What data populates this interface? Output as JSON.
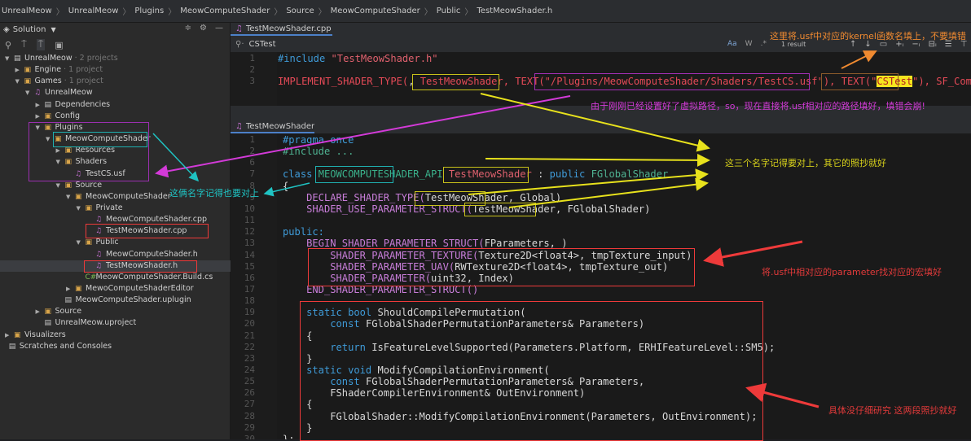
{
  "breadcrumb": [
    "UnrealMeow",
    "UnrealMeow",
    "Plugins",
    "MeowComputeShader",
    "Source",
    "MeowComputeShader",
    "Public",
    "TestMeowShader.h"
  ],
  "sidebar": {
    "title": "Solution",
    "tree": [
      {
        "label": "UnrealMeow",
        "suffix": " · 2 projects",
        "d": 0,
        "a": "▼",
        "icon": "proj"
      },
      {
        "label": "Engine",
        "suffix": " · 1 project",
        "d": 1,
        "a": "▶",
        "icon": "fold"
      },
      {
        "label": "Games",
        "suffix": " · 1 project",
        "d": 1,
        "a": "▼",
        "icon": "fold"
      },
      {
        "label": "UnrealMeow",
        "suffix": "",
        "d": 2,
        "a": "▼",
        "icon": "file"
      },
      {
        "label": "Dependencies",
        "suffix": "",
        "d": 3,
        "a": "▶",
        "icon": "proj"
      },
      {
        "label": "Config",
        "suffix": "",
        "d": 3,
        "a": "▶",
        "icon": "fold"
      },
      {
        "label": "Plugins",
        "suffix": "",
        "d": 3,
        "a": "▼",
        "icon": "fold"
      },
      {
        "label": "MeowComputeShader",
        "suffix": "",
        "d": 4,
        "a": "▼",
        "icon": "fold"
      },
      {
        "label": "Resources",
        "suffix": "",
        "d": 5,
        "a": "▶",
        "icon": "fold"
      },
      {
        "label": "Shaders",
        "suffix": "",
        "d": 5,
        "a": "▼",
        "icon": "fold"
      },
      {
        "label": "TestCS.usf",
        "suffix": "",
        "d": 6,
        "a": "",
        "icon": "file"
      },
      {
        "label": "Source",
        "suffix": "",
        "d": 5,
        "a": "▼",
        "icon": "fold"
      },
      {
        "label": "MeowComputeShader",
        "suffix": "",
        "d": 6,
        "a": "▼",
        "icon": "fold"
      },
      {
        "label": "Private",
        "suffix": "",
        "d": 7,
        "a": "▼",
        "icon": "fold"
      },
      {
        "label": "MeowComputeShader.cpp",
        "suffix": "",
        "d": 8,
        "a": "",
        "icon": "file"
      },
      {
        "label": "TestMeowShader.cpp",
        "suffix": "",
        "d": 8,
        "a": "",
        "icon": "file"
      },
      {
        "label": "Public",
        "suffix": "",
        "d": 7,
        "a": "▼",
        "icon": "fold"
      },
      {
        "label": "MeowComputeShader.h",
        "suffix": "",
        "d": 8,
        "a": "",
        "icon": "file"
      },
      {
        "label": "TestMeowShader.h",
        "suffix": "",
        "d": 8,
        "a": "",
        "icon": "file",
        "selected": true
      },
      {
        "label": "MeowComputeShader.Build.cs",
        "suffix": "",
        "d": 7,
        "a": "",
        "icon": "cs"
      },
      {
        "label": "MewoComputeShaderEditor",
        "suffix": "",
        "d": 6,
        "a": "▶",
        "icon": "fold"
      },
      {
        "label": "MeowComputeShader.uplugin",
        "suffix": "",
        "d": 5,
        "a": "",
        "icon": "proj"
      },
      {
        "label": "Source",
        "suffix": "",
        "d": 3,
        "a": "▶",
        "icon": "fold"
      },
      {
        "label": "UnrealMeow.uproject",
        "suffix": "",
        "d": 3,
        "a": "",
        "icon": "proj"
      },
      {
        "label": "Visualizers",
        "suffix": "",
        "d": 0,
        "a": "▶",
        "icon": "fold"
      },
      {
        "label": "Scratches and Consoles",
        "suffix": "",
        "d": -1,
        "a": "",
        "icon": "proj"
      }
    ]
  },
  "editor1": {
    "tab": "TestMeowShader.cpp",
    "search": "CSTest",
    "search_result": "1 result",
    "line_numbers": [
      "1",
      "2",
      "3"
    ],
    "lines": [
      [
        [
          "#include ",
          "kw"
        ],
        [
          "\"TestMeowShader.h\"",
          "str"
        ]
      ],
      [],
      [
        [
          "IMPLEMENT_SHADER_TYPE(",
          "red"
        ],
        [
          ", ",
          "pl"
        ],
        [
          "TestMeowShader",
          "red"
        ],
        [
          ", TEXT(",
          "red"
        ],
        [
          "\"/Plugins/MeowComputeShader/Shaders/TestCS.usf\"",
          "red"
        ],
        [
          "), ",
          "red"
        ],
        [
          "TEXT(\"",
          "red"
        ],
        [
          "CSTest",
          "hl"
        ],
        [
          "\"), SF_Comput",
          "red"
        ]
      ]
    ]
  },
  "editor2": {
    "tab": "TestMeowShader.h",
    "line_numbers": [
      "1",
      "2",
      "6",
      "7",
      "8",
      "9",
      "10",
      "11",
      "12",
      "13",
      "14",
      "15",
      "16",
      "17",
      "18",
      "19",
      "20",
      "21",
      "22",
      "23",
      "24",
      "25",
      "26",
      "27",
      "28",
      "29",
      "30"
    ],
    "lines": [
      [
        [
          "#pragma once",
          "kw"
        ]
      ],
      [
        [
          "#include ...",
          "ty"
        ]
      ],
      [],
      [
        [
          "class ",
          "kw"
        ],
        [
          "MEOWCOMPUTESHADER_API ",
          "api"
        ],
        [
          "TestMeowShader",
          "str"
        ],
        [
          " : ",
          "pl"
        ],
        [
          "public ",
          "kw"
        ],
        [
          "FGlobalShader",
          "ty"
        ]
      ],
      [
        [
          "{",
          "pl"
        ]
      ],
      [
        [
          "    DECLARE_SHADER_TYPE(",
          "mac"
        ],
        [
          "TestMeowShader",
          "pl"
        ],
        [
          ", Global)",
          "pl"
        ]
      ],
      [
        [
          "    SHADER_USE_PARAMETER_STRUCT(",
          "mac"
        ],
        [
          "TestMeowShader",
          "pl"
        ],
        [
          ", FGlobalShader)",
          "pl"
        ]
      ],
      [],
      [
        [
          "public:",
          "kw"
        ]
      ],
      [
        [
          "    BEGIN_SHADER_PARAMETER_STRUCT(",
          "mac"
        ],
        [
          "FParameters, )",
          "pl"
        ]
      ],
      [
        [
          "        SHADER_PARAMETER_TEXTURE(",
          "mac"
        ],
        [
          "Texture2D<float4>, tmpTexture_input)",
          "pl"
        ]
      ],
      [
        [
          "        SHADER_PARAMETER_UAV(",
          "mac"
        ],
        [
          "RWTexture2D<float4>, tmpTexture_out)",
          "pl"
        ]
      ],
      [
        [
          "        SHADER_PARAMETER(",
          "mac"
        ],
        [
          "uint32, Index)",
          "pl"
        ]
      ],
      [
        [
          "    END_SHADER_PARAMETER_STRUCT()",
          "mac"
        ]
      ],
      [],
      [
        [
          "    static bool ",
          "kw"
        ],
        [
          "ShouldCompilePermutation(",
          "pl"
        ]
      ],
      [
        [
          "        const ",
          "kw"
        ],
        [
          "FGlobalShaderPermutationParameters& Parameters)",
          "pl"
        ]
      ],
      [
        [
          "    {",
          "pl"
        ]
      ],
      [
        [
          "        return ",
          "kw"
        ],
        [
          "IsFeatureLevelSupported(Parameters.Platform, ERHIFeatureLevel::SM5);",
          "pl"
        ]
      ],
      [
        [
          "    }",
          "pl"
        ]
      ],
      [
        [
          "    static void ",
          "kw"
        ],
        [
          "ModifyCompilationEnvironment(",
          "pl"
        ]
      ],
      [
        [
          "        const ",
          "kw"
        ],
        [
          "FGlobalShaderPermutationParameters& Parameters,",
          "pl"
        ]
      ],
      [
        [
          "        FShaderCompilerEnvironment& OutEnvironment)",
          "pl"
        ]
      ],
      [
        [
          "    {",
          "pl"
        ]
      ],
      [
        [
          "        FGlobalShader::ModifyCompilationEnvironment(Parameters, OutEnvironment);",
          "pl"
        ]
      ],
      [
        [
          "    }",
          "pl"
        ]
      ],
      [
        [
          "};",
          "pl"
        ]
      ]
    ]
  },
  "annotations": {
    "kernel_note": "这里将.usf中对应的kernel函数名填上，不要填错",
    "path_note": "由于刚刚已经设置好了虚拟路径，so，现在直接将.usf相对应的路径填好，填错会崩!",
    "names_note": "这三个名字记得要对上，其它的照抄就好",
    "module_note": "这俩名字记得也要对上",
    "param_note": "将.usf中相对应的parameter找对应的宏填好",
    "copy_note": "具体没仔细研究 这两段照抄就好"
  },
  "colors": {
    "orange": "#f08a30",
    "magenta": "#d33ad8",
    "yellow": "#e8e21c",
    "teal": "#1fc3c3",
    "red": "#ee3a3a",
    "purple": "#9b2fb0"
  }
}
